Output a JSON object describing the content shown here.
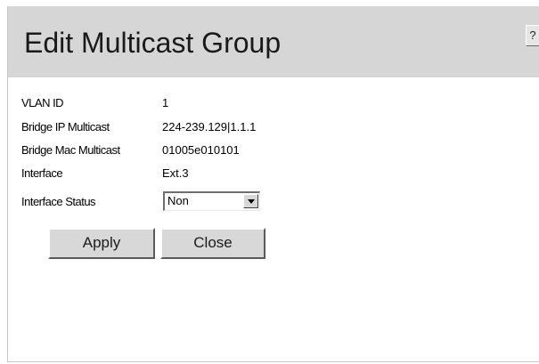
{
  "header": {
    "title": "Edit Multicast Group",
    "help_label": "?"
  },
  "form": {
    "fields": [
      {
        "label": "VLAN ID",
        "value": "1"
      },
      {
        "label": "Bridge IP Multicast",
        "value": "224-239.129|1.1.1"
      },
      {
        "label": "Bridge Mac Multicast",
        "value": "01005e010101"
      },
      {
        "label": "Interface",
        "value": "Ext.3"
      }
    ],
    "status": {
      "label": "Interface Status",
      "selected": "Non"
    }
  },
  "buttons": {
    "apply": "Apply",
    "close": "Close"
  }
}
